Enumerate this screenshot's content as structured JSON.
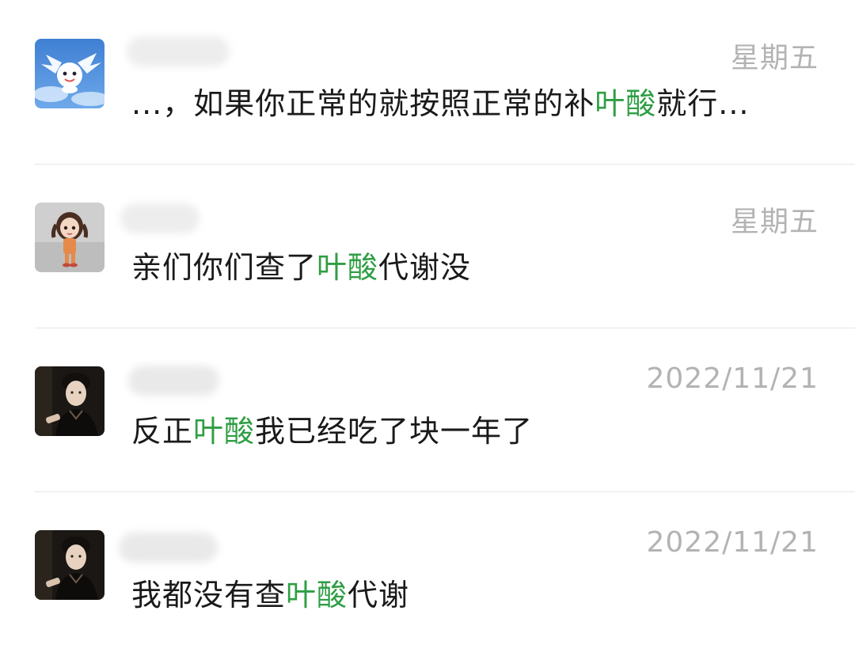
{
  "conversations": [
    {
      "time": "星期五",
      "preview": {
        "before": "...，如果你正常的就按照正常的补",
        "keyword": "叶酸",
        "after": "就行..."
      },
      "avatar_icon": "cartoon-sky-avatar"
    },
    {
      "time": "星期五",
      "preview": {
        "before": "亲们你们查了",
        "keyword": "叶酸",
        "after": "代谢没"
      },
      "avatar_icon": "doll-girl-avatar"
    },
    {
      "time": "2022/11/21",
      "preview": {
        "before": "反正",
        "keyword": "叶酸",
        "after": "我已经吃了块一年了"
      },
      "avatar_icon": "man-portrait-avatar"
    },
    {
      "time": "2022/11/21",
      "preview": {
        "before": "我都没有查",
        "keyword": "叶酸",
        "after": "代谢"
      },
      "avatar_icon": "man-portrait-avatar"
    }
  ],
  "colors": {
    "keyword": "#2f9e44",
    "timestamp": "#b3b3b3",
    "text": "#1a1a1a",
    "divider": "#e6e6e6"
  }
}
